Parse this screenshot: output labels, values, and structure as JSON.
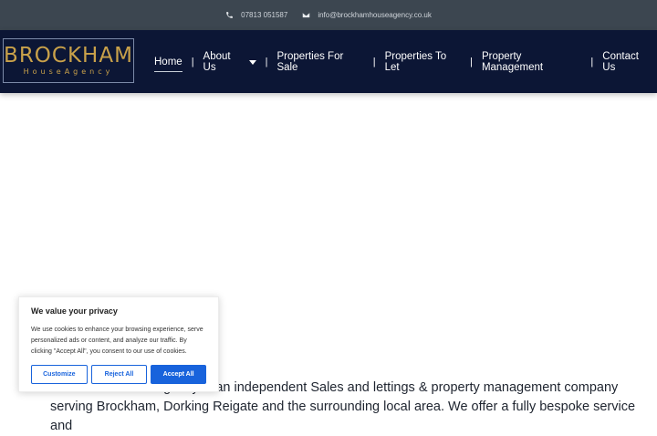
{
  "topbar": {
    "phone": "07813 051587",
    "email": "info@brockhamhouseagency.co.uk"
  },
  "logo": {
    "main": "BROCKHAM",
    "sub": "HouseAgency"
  },
  "nav": {
    "items": [
      "Home",
      "About Us",
      "Properties For Sale",
      "Properties To Let",
      "Property Management",
      "Contact Us"
    ]
  },
  "content": {
    "text": "Brockham House Agency is an independent Sales and lettings & property management company serving Brockham, Dorking Reigate and the surrounding local area. We offer a fully bespoke service and"
  },
  "cookie": {
    "title": "We value your privacy",
    "body": "We use cookies to enhance your browsing experience, serve personalized ads or content, and analyze our traffic. By clicking \"Accept All\", you consent to our use of cookies.",
    "customize": "Customize",
    "reject": "Reject All",
    "accept": "Accept All"
  },
  "colors": {
    "header_bg": "#0c1635",
    "topbar_bg": "#3c4650",
    "logo_gold": "#c9a14a",
    "accent_blue": "#1863dc"
  }
}
